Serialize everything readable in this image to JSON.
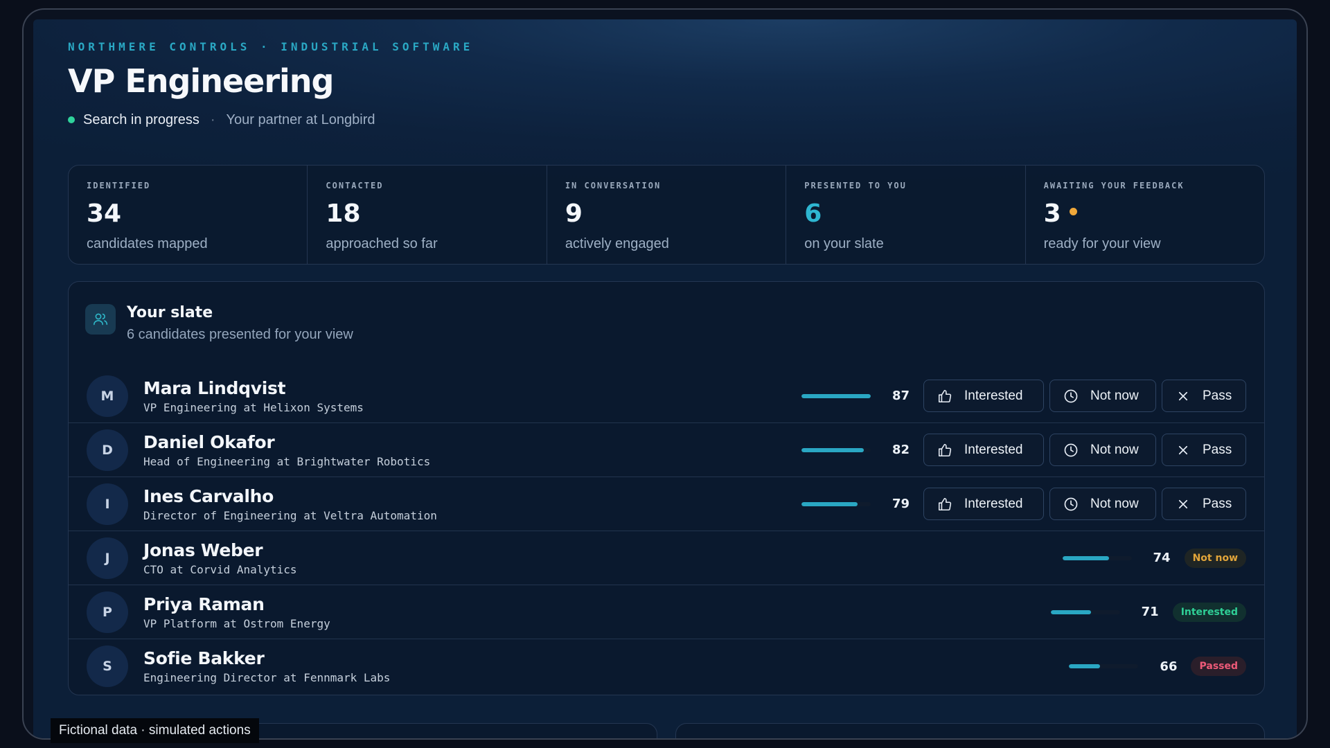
{
  "header": {
    "eyebrow": "NORTHMERE CONTROLS · INDUSTRIAL SOFTWARE",
    "title": "VP Engineering",
    "status": "Search in progress",
    "separator": "·",
    "partner": "Your partner at Longbird"
  },
  "stats": [
    {
      "label": "IDENTIFIED",
      "value": "34",
      "sub": "candidates mapped"
    },
    {
      "label": "CONTACTED",
      "value": "18",
      "sub": "approached so far"
    },
    {
      "label": "IN CONVERSATION",
      "value": "9",
      "sub": "actively engaged"
    },
    {
      "label": "PRESENTED TO YOU",
      "value": "6",
      "sub": "on your slate"
    },
    {
      "label": "AWAITING YOUR FEEDBACK",
      "value": "3",
      "sub": "ready for your view"
    }
  ],
  "slate": {
    "title": "Your slate",
    "subtitle": "6 candidates presented for your view",
    "icon": "users-icon"
  },
  "actions": {
    "interested": "Interested",
    "not_now": "Not now",
    "pass": "Pass"
  },
  "candidates": [
    {
      "initial": "M",
      "name": "Mara Lindqvist",
      "role": "VP Engineering at Helixon Systems",
      "score": "87",
      "score_value": 87
    },
    {
      "initial": "D",
      "name": "Daniel Okafor",
      "role": "Head of Engineering at Brightwater Robotics",
      "score": "82",
      "score_value": 82
    },
    {
      "initial": "I",
      "name": "Ines Carvalho",
      "role": "Director of Engineering at Veltra Automation",
      "score": "79",
      "score_value": 79
    },
    {
      "initial": "J",
      "name": "Jonas Weber",
      "role": "CTO at Corvid Analytics",
      "score": "74",
      "score_value": 74,
      "status": "Not now"
    },
    {
      "initial": "P",
      "name": "Priya Raman",
      "role": "VP Platform at Ostrom Energy",
      "score": "71",
      "score_value": 71,
      "status": "Interested"
    },
    {
      "initial": "S",
      "name": "Sofie Bakker",
      "role": "Engineering Director at Fennmark Labs",
      "score": "66",
      "score_value": 66,
      "status": "Passed"
    }
  ],
  "footnote": "Fictional data · simulated actions",
  "colors": {
    "accent": "#2aa7c3",
    "status_green": "#2fd29b",
    "awaiting_amber": "#f0a83a",
    "not_now": "#e2a53a",
    "interested": "#2fcf96",
    "passed": "#ee5a78"
  }
}
